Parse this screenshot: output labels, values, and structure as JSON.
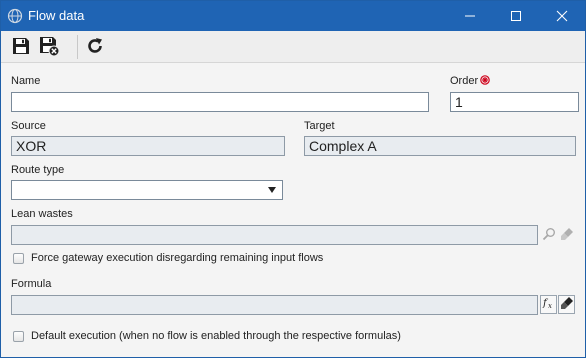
{
  "window": {
    "title": "Flow data",
    "icons": {
      "app": "globe-icon",
      "minimize": "minimize-icon",
      "maximize": "maximize-icon",
      "close": "close-icon"
    }
  },
  "toolbar": {
    "save_icon": "save-icon",
    "save_close_icon": "save-and-close-icon",
    "refresh_icon": "refresh-icon"
  },
  "form": {
    "name": {
      "label": "Name",
      "value": ""
    },
    "order": {
      "label": "Order",
      "value": "1",
      "required_icon": "required-icon"
    },
    "source": {
      "label": "Source",
      "value": "XOR"
    },
    "target": {
      "label": "Target",
      "value": "Complex A"
    },
    "route_type": {
      "label": "Route type",
      "value": ""
    },
    "lean_wastes": {
      "label": "Lean wastes",
      "value": "",
      "search_icon": "search-icon",
      "clear_icon": "eraser-icon"
    },
    "force_gateway": {
      "label": "Force gateway execution disregarding remaining input flows",
      "checked": false
    },
    "formula": {
      "label": "Formula",
      "value": "",
      "fx_icon": "function-icon",
      "clear_icon": "eraser-icon"
    },
    "default_execution": {
      "label": "Default execution (when no flow is enabled through the respective formulas)",
      "checked": false
    }
  },
  "colors": {
    "titlebar": "#1f64b4",
    "required": "#d0021b"
  }
}
